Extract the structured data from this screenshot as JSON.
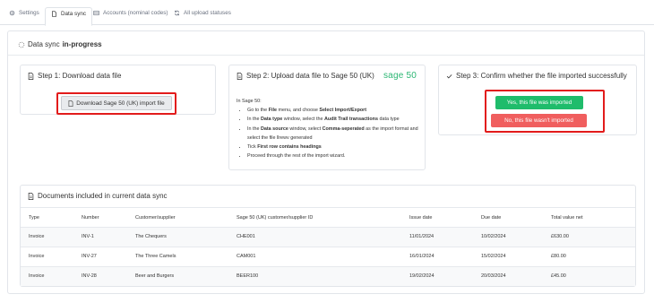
{
  "tabs": [
    {
      "label": "Settings",
      "icon": "gear-icon"
    },
    {
      "label": "Data sync",
      "icon": "document-icon"
    },
    {
      "label": "Accounts (nominal codes)",
      "icon": "list-icon"
    },
    {
      "label": "All upload statuses",
      "icon": "sync-icon"
    }
  ],
  "sync": {
    "title_prefix": "Data sync",
    "title_status": "in-progress"
  },
  "step1": {
    "title": "Step 1: Download data file",
    "button": "Download Sage 50 (UK) import file"
  },
  "step2": {
    "title": "Step 2: Upload data file to Sage 50 (UK)",
    "logo_word": "sage",
    "logo_num": "50",
    "intro": "In Sage 50:",
    "items": [
      {
        "pre": "Go to the ",
        "b1": "File",
        "mid": " menu, and choose ",
        "b2": "Select Import/Export",
        "post": ""
      },
      {
        "pre": "In the ",
        "b1": "Data type",
        "mid": " window, select the ",
        "b2": "Audit Trail transactions",
        "post": " data type"
      },
      {
        "pre": "In the ",
        "b1": "Data source",
        "mid": " window, select ",
        "b2": "Comma-seperated",
        "post": " as the import format and select the file llrewv generated"
      },
      {
        "pre": "Tick ",
        "b1": "First row contains headings",
        "mid": "",
        "b2": "",
        "post": ""
      },
      {
        "pre": "Proceed through the rest of the import wizard.",
        "b1": "",
        "mid": "",
        "b2": "",
        "post": ""
      }
    ]
  },
  "step3": {
    "title": "Step 3: Confirm whether the file imported successfully",
    "yes_button": "Yes, this file was imported",
    "no_button": "No, this file wasn't imported"
  },
  "documents": {
    "title": "Documents included in current data sync",
    "columns": [
      "Type",
      "Number",
      "Customer/supplier",
      "Sage 50 (UK) customer/supplier ID",
      "Issue date",
      "Due date",
      "Total value net"
    ],
    "rows": [
      [
        "Invoice",
        "INV-1",
        "The Chequers",
        "CHE001",
        "11/01/2024",
        "10/02/2024",
        "£630.00"
      ],
      [
        "Invoice",
        "INV-27",
        "The Three Camels",
        "CAM001",
        "16/01/2024",
        "15/02/2024",
        "£80.00"
      ],
      [
        "Invoice",
        "INV-28",
        "Beer and Burgers",
        "BEER100",
        "19/02/2024",
        "20/03/2024",
        "£45.00"
      ]
    ]
  },
  "colors": {
    "accent_green": "#1fbc6b",
    "accent_red": "#f05e5e",
    "highlight": "#e21b1b",
    "sage_green": "#2bb673"
  }
}
